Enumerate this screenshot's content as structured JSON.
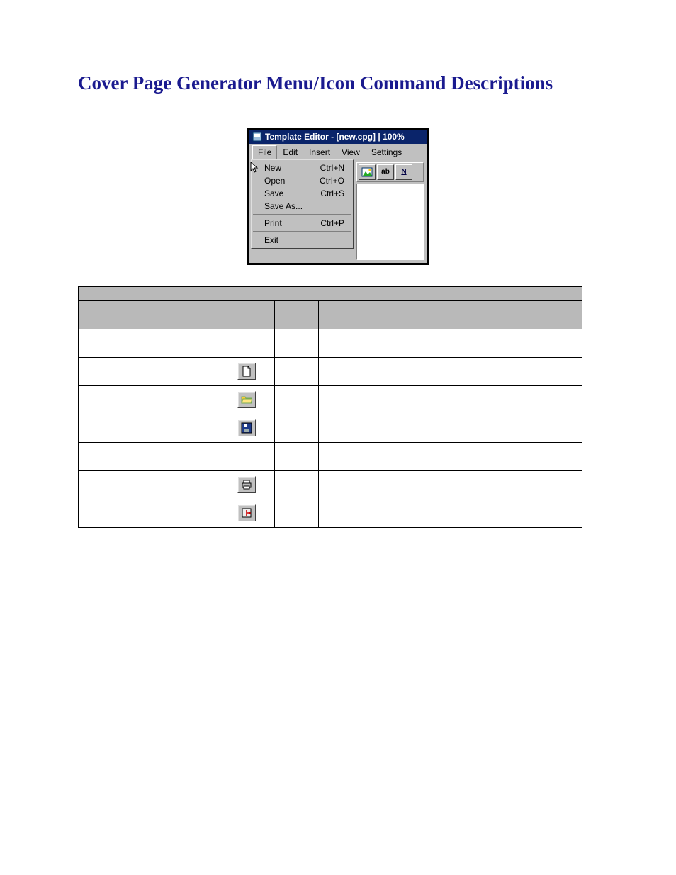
{
  "heading": "Cover Page Generator Menu/Icon Command Descriptions",
  "window": {
    "title": "Template Editor - [new.cpg] | 100%",
    "menubar": [
      "File",
      "Edit",
      "Insert",
      "View",
      "Settings"
    ],
    "active_menu_index": 0,
    "dropdown": {
      "groups": [
        [
          {
            "label": "New",
            "shortcut": "Ctrl+N"
          },
          {
            "label": "Open",
            "shortcut": "Ctrl+O"
          },
          {
            "label": "Save",
            "shortcut": "Ctrl+S"
          },
          {
            "label": "Save As...",
            "shortcut": ""
          }
        ],
        [
          {
            "label": "Print",
            "shortcut": "Ctrl+P"
          }
        ],
        [
          {
            "label": "Exit",
            "shortcut": ""
          }
        ]
      ]
    },
    "toolbar_icons": [
      "image-insert-icon",
      "textfield-ab-icon",
      "bold-n-icon"
    ],
    "toolbar_labels": [
      "",
      "ab",
      "N"
    ]
  },
  "table": {
    "rows": [
      {
        "icon": null,
        "icon_name": null
      },
      {
        "icon": "new",
        "icon_name": "new-document-icon"
      },
      {
        "icon": "open",
        "icon_name": "open-folder-icon"
      },
      {
        "icon": "save",
        "icon_name": "save-disk-icon"
      },
      {
        "icon": null,
        "icon_name": null
      },
      {
        "icon": "print",
        "icon_name": "printer-icon"
      },
      {
        "icon": "exit",
        "icon_name": "exit-door-icon"
      }
    ]
  }
}
